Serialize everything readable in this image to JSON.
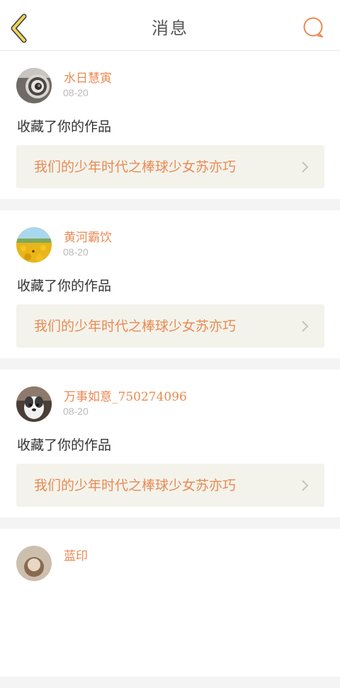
{
  "header": {
    "title": "消息"
  },
  "colors": {
    "accent": "#e98a52",
    "back_icon": "#ecd35a",
    "link_background": "#f3f3ec"
  },
  "icons": {
    "back": "chevron-left-icon",
    "chat": "chat-bubble-icon",
    "link": "chevron-right-icon"
  },
  "messages": [
    {
      "user": "水日慧寅",
      "date": "08-20",
      "action": "收藏了你的作品",
      "work": "我们的少年时代之棒球少女苏亦巧"
    },
    {
      "user": "黄河霸饮",
      "date": "08-20",
      "action": "收藏了你的作品",
      "work": "我们的少年时代之棒球少女苏亦巧"
    },
    {
      "user": "万事如意_750274096",
      "date": "08-20",
      "action": "收藏了你的作品",
      "work": "我们的少年时代之棒球少女苏亦巧"
    },
    {
      "user": "蓝印",
      "date": "",
      "action": "",
      "work": ""
    }
  ]
}
